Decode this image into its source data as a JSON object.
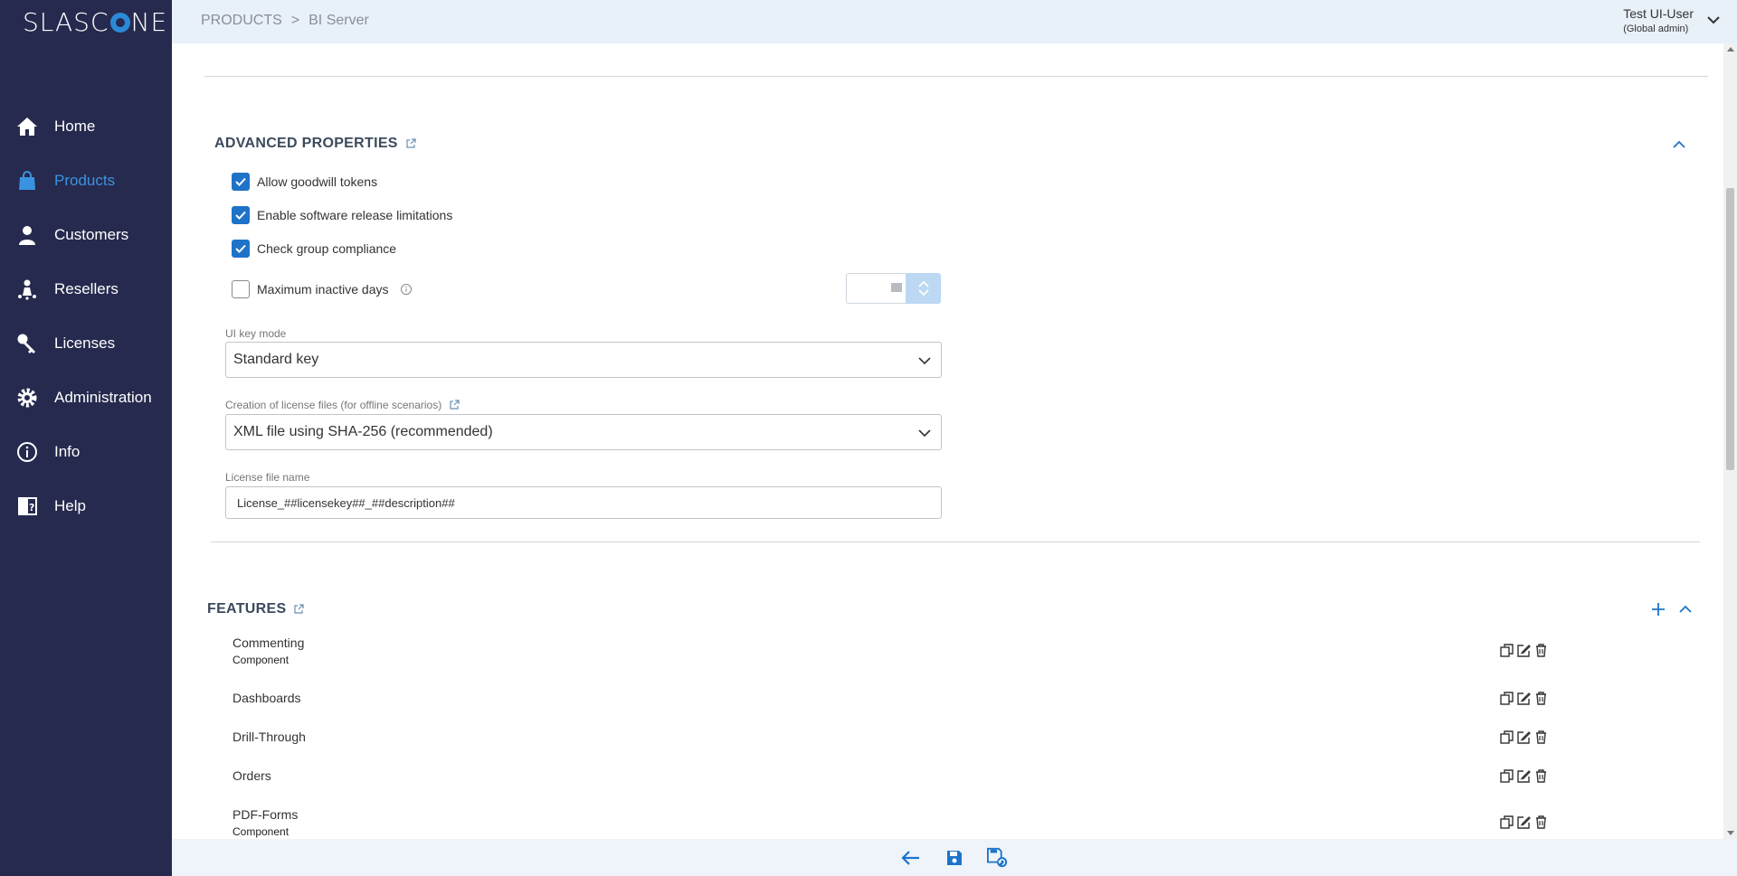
{
  "app": {
    "logo_text_a": "SLASC",
    "logo_text_b": "NE"
  },
  "sidebar": {
    "items": [
      {
        "label": "Home",
        "icon": "home-icon",
        "active": false
      },
      {
        "label": "Products",
        "icon": "shopping-bag-icon",
        "active": true
      },
      {
        "label": "Customers",
        "icon": "person-icon",
        "active": false
      },
      {
        "label": "Resellers",
        "icon": "reseller-icon",
        "active": false
      },
      {
        "label": "Licenses",
        "icon": "key-icon",
        "active": false
      },
      {
        "label": "Administration",
        "icon": "gear-icon",
        "active": false
      },
      {
        "label": "Info",
        "icon": "info-icon",
        "active": false
      },
      {
        "label": "Help",
        "icon": "help-icon",
        "active": false
      }
    ]
  },
  "header": {
    "breadcrumb": [
      "PRODUCTS",
      "BI Server"
    ],
    "user_name": "Test UI-User",
    "user_role": "(Global admin)"
  },
  "advanced": {
    "title": "ADVANCED PROPERTIES",
    "checkboxes": [
      {
        "label": "Allow goodwill tokens",
        "checked": true
      },
      {
        "label": "Enable software release limitations",
        "checked": true
      },
      {
        "label": "Check group compliance",
        "checked": true
      },
      {
        "label": "Maximum inactive days",
        "checked": false
      }
    ],
    "ui_key_mode_label": "UI key mode",
    "ui_key_mode_value": "Standard key",
    "license_file_creation_label": "Creation of license files (for offline scenarios)",
    "license_file_creation_value": "XML file using SHA-256 (recommended)",
    "license_file_name_label": "License file name",
    "license_file_name_value": "License_##licensekey##_##description##"
  },
  "features": {
    "title": "FEATURES",
    "items": [
      {
        "name": "Commenting",
        "type": "Component"
      },
      {
        "name": "Dashboards",
        "type": ""
      },
      {
        "name": "Drill-Through",
        "type": ""
      },
      {
        "name": "Orders",
        "type": ""
      },
      {
        "name": "PDF-Forms",
        "type": "Component"
      }
    ]
  },
  "colors": {
    "sidebar_bg": "#262a4e",
    "accent": "#1e73c8",
    "active_nav": "#3a93e0",
    "topbar_bg": "#e8f0f8"
  }
}
